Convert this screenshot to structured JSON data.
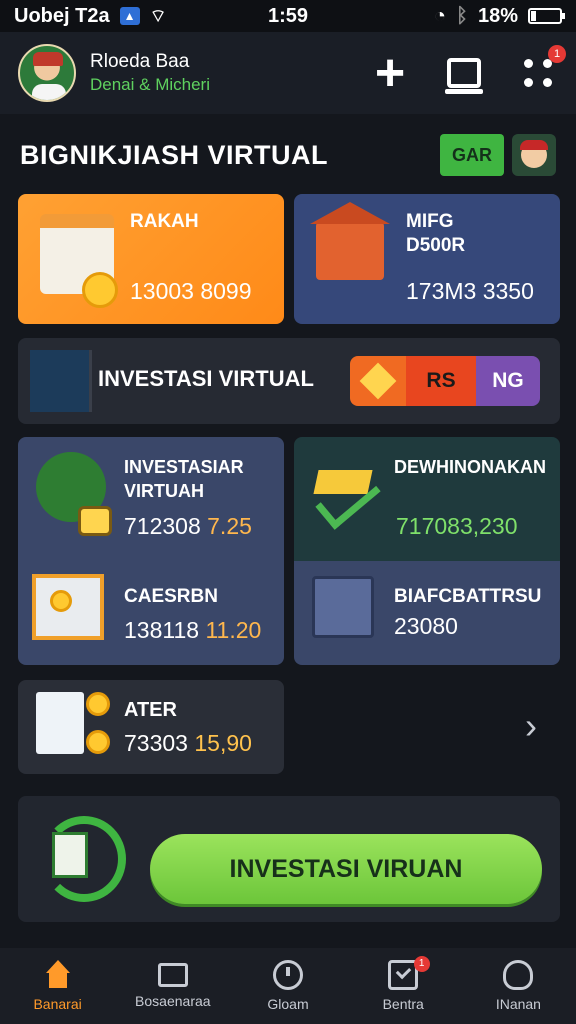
{
  "status_bar": {
    "carrier": "Uobej T2a",
    "time": "1:59",
    "battery": "18%",
    "battery_level": 0.18
  },
  "header": {
    "user_name": "Rloeda Baa",
    "user_sub": "Denai & Micheri",
    "notification_count": "1"
  },
  "page": {
    "title": "BIGNIKJIASH VIRTUAL",
    "gar_label": "GAR"
  },
  "cards": {
    "orange": {
      "title": "RAKAH",
      "value": "13003 8099"
    },
    "blue": {
      "title_line1": "MIFG",
      "title_line2": "D500R",
      "value": "173M3 3350"
    },
    "banner": {
      "title": "INVESTASI VIRTUAL",
      "seg_2": "RS",
      "seg_3": "NG"
    },
    "invest": {
      "title_line1": "INVESTASIAR",
      "title_line2": "VIRTUAH",
      "value_prefix": "712308",
      "value_hl": "7.25"
    },
    "gold": {
      "title": "DEWHINONAKAN",
      "value": "717083,230"
    },
    "cashier": {
      "title": "CAESRBN",
      "value_prefix": "138118",
      "value_hl": "11.20"
    },
    "board": {
      "title": "BIAFCBATTRSU",
      "value": "23080"
    },
    "ater": {
      "title": "ATER",
      "value_prefix": "73303",
      "value_hl": "15,90"
    }
  },
  "cta": {
    "label": "INVESTASI VIRUAN"
  },
  "bottom_nav": {
    "items": [
      {
        "label": "Banarai",
        "icon": "home-icon",
        "active": true
      },
      {
        "label": "Bosaenaraa",
        "icon": "monitor-icon",
        "active": false
      },
      {
        "label": "Gloam",
        "icon": "compass-icon",
        "active": false
      },
      {
        "label": "Bentra",
        "icon": "check-icon",
        "active": false,
        "badge": "1"
      },
      {
        "label": "INanan",
        "icon": "person-icon",
        "active": false
      }
    ]
  },
  "colors": {
    "accent_orange": "#ff8a18",
    "accent_green": "#6cc63a",
    "card_blue": "#36487a",
    "background": "#14171d"
  }
}
